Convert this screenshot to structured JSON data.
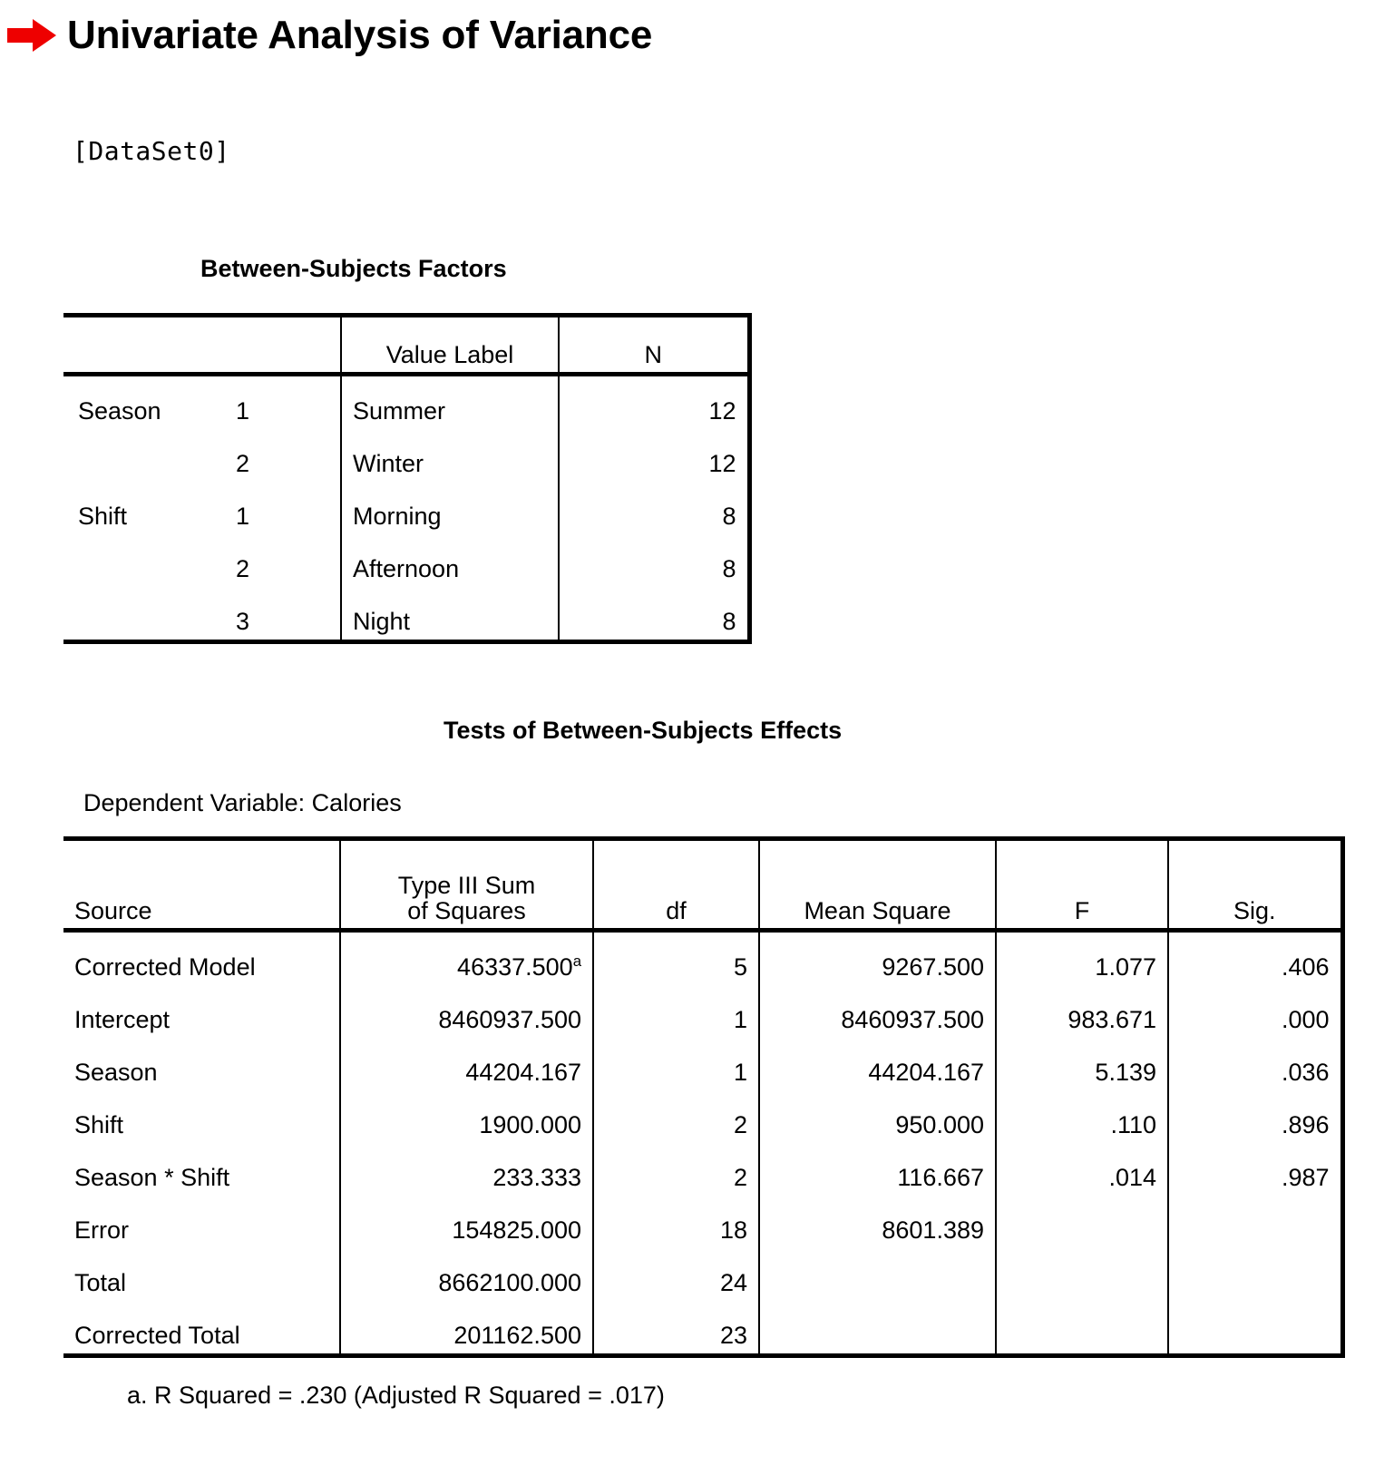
{
  "header": {
    "arrow_icon": "red-right-arrow-icon",
    "title": "Univariate Analysis of Variance",
    "arrow_color": "#EE0000"
  },
  "dataset_line": "[DataSet0]",
  "between_subjects_factors": {
    "caption": "Between-Subjects Factors",
    "columns": [
      "",
      "",
      "Value Label",
      "N"
    ],
    "rows": [
      {
        "factor": "Season",
        "level": "1",
        "value_label": "Summer",
        "n": "12"
      },
      {
        "factor": "",
        "level": "2",
        "value_label": "Winter",
        "n": "12"
      },
      {
        "factor": "Shift",
        "level": "1",
        "value_label": "Morning",
        "n": "8"
      },
      {
        "factor": "",
        "level": "2",
        "value_label": "Afternoon",
        "n": "8"
      },
      {
        "factor": "",
        "level": "3",
        "value_label": "Night",
        "n": "8"
      }
    ]
  },
  "tests_of_between_subjects_effects": {
    "caption": "Tests of Between-Subjects Effects",
    "dependent_variable": "Dependent Variable: Calories",
    "columns": {
      "source": "Source",
      "ss_line1": "Type III Sum",
      "ss_line2": "of Squares",
      "df": "df",
      "mean_square": "Mean Square",
      "f": "F",
      "sig": "Sig."
    },
    "rows": [
      {
        "source": "Corrected Model",
        "ss": "46337.500",
        "ss_sup": "a",
        "df": "5",
        "ms": "9267.500",
        "f": "1.077",
        "sig": ".406"
      },
      {
        "source": "Intercept",
        "ss": "8460937.500",
        "ss_sup": "",
        "df": "1",
        "ms": "8460937.500",
        "f": "983.671",
        "sig": ".000"
      },
      {
        "source": "Season",
        "ss": "44204.167",
        "ss_sup": "",
        "df": "1",
        "ms": "44204.167",
        "f": "5.139",
        "sig": ".036"
      },
      {
        "source": "Shift",
        "ss": "1900.000",
        "ss_sup": "",
        "df": "2",
        "ms": "950.000",
        "f": ".110",
        "sig": ".896"
      },
      {
        "source": "Season * Shift",
        "ss": "233.333",
        "ss_sup": "",
        "df": "2",
        "ms": "116.667",
        "f": ".014",
        "sig": ".987"
      },
      {
        "source": "Error",
        "ss": "154825.000",
        "ss_sup": "",
        "df": "18",
        "ms": "8601.389",
        "f": "",
        "sig": ""
      },
      {
        "source": "Total",
        "ss": "8662100.000",
        "ss_sup": "",
        "df": "24",
        "ms": "",
        "f": "",
        "sig": ""
      },
      {
        "source": "Corrected Total",
        "ss": "201162.500",
        "ss_sup": "",
        "df": "23",
        "ms": "",
        "f": "",
        "sig": ""
      }
    ],
    "footnote": "a. R Squared = .230 (Adjusted R Squared = .017)"
  },
  "chart_data": {
    "type": "table",
    "title": "Tests of Between-Subjects Effects",
    "subtitle": "Dependent Variable: Calories",
    "columns": [
      "Source",
      "Type III Sum of Squares",
      "df",
      "Mean Square",
      "F",
      "Sig."
    ],
    "values": [
      [
        "Corrected Model",
        46337.5,
        5,
        9267.5,
        1.077,
        0.406
      ],
      [
        "Intercept",
        8460937.5,
        1,
        8460937.5,
        983.671,
        0.0
      ],
      [
        "Season",
        44204.167,
        1,
        44204.167,
        5.139,
        0.036
      ],
      [
        "Shift",
        1900.0,
        2,
        950.0,
        0.11,
        0.896
      ],
      [
        "Season * Shift",
        233.333,
        2,
        116.667,
        0.014,
        0.987
      ],
      [
        "Error",
        154825.0,
        18,
        8601.389,
        null,
        null
      ],
      [
        "Total",
        8662100.0,
        24,
        null,
        null,
        null
      ],
      [
        "Corrected Total",
        201162.5,
        23,
        null,
        null,
        null
      ]
    ],
    "annotations": [
      "a. R Squared = .230 (Adjusted R Squared = .017)"
    ]
  }
}
